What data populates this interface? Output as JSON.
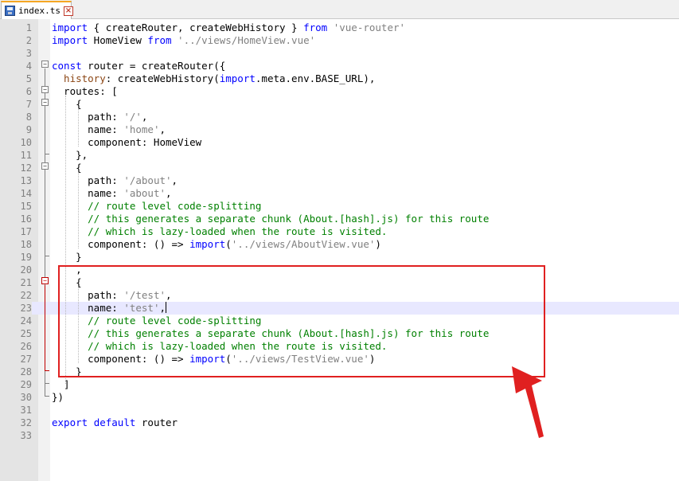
{
  "tab": {
    "filename": "index.ts"
  },
  "lines": [
    {
      "n": "1",
      "tokens": [
        [
          "kw",
          "import"
        ],
        [
          "fn",
          " { createRouter, createWebHistory } "
        ],
        [
          "kw",
          "from"
        ],
        [
          "str",
          " 'vue-router'"
        ]
      ]
    },
    {
      "n": "2",
      "tokens": [
        [
          "kw",
          "import"
        ],
        [
          "fn",
          " HomeView "
        ],
        [
          "kw",
          "from"
        ],
        [
          "str",
          " '../views/HomeView.vue'"
        ]
      ]
    },
    {
      "n": "3",
      "tokens": []
    },
    {
      "n": "4",
      "tokens": [
        [
          "kw",
          "const"
        ],
        [
          "fn",
          " router = createRouter({"
        ]
      ]
    },
    {
      "n": "5",
      "tokens": [
        [
          "orange",
          "  history"
        ],
        [
          "fn",
          ": createWebHistory("
        ],
        [
          "kw",
          "import"
        ],
        [
          "fn",
          ".meta.env.BASE_URL),"
        ]
      ]
    },
    {
      "n": "6",
      "tokens": [
        [
          "fn",
          "  routes: ["
        ]
      ]
    },
    {
      "n": "7",
      "tokens": [
        [
          "fn",
          "    {"
        ]
      ]
    },
    {
      "n": "8",
      "tokens": [
        [
          "fn",
          "      path: "
        ],
        [
          "str",
          "'/'"
        ],
        [
          "fn",
          ","
        ]
      ]
    },
    {
      "n": "9",
      "tokens": [
        [
          "fn",
          "      name: "
        ],
        [
          "str",
          "'home'"
        ],
        [
          "fn",
          ","
        ]
      ]
    },
    {
      "n": "10",
      "tokens": [
        [
          "fn",
          "      component: HomeView"
        ]
      ]
    },
    {
      "n": "11",
      "tokens": [
        [
          "fn",
          "    },"
        ]
      ]
    },
    {
      "n": "12",
      "tokens": [
        [
          "fn",
          "    {"
        ]
      ]
    },
    {
      "n": "13",
      "tokens": [
        [
          "fn",
          "      path: "
        ],
        [
          "str",
          "'/about'"
        ],
        [
          "fn",
          ","
        ]
      ]
    },
    {
      "n": "14",
      "tokens": [
        [
          "fn",
          "      name: "
        ],
        [
          "str",
          "'about'"
        ],
        [
          "fn",
          ","
        ]
      ]
    },
    {
      "n": "15",
      "tokens": [
        [
          "cmt",
          "      // route level code-splitting"
        ]
      ]
    },
    {
      "n": "16",
      "tokens": [
        [
          "cmt",
          "      // this generates a separate chunk (About.[hash].js) for this route"
        ]
      ]
    },
    {
      "n": "17",
      "tokens": [
        [
          "cmt",
          "      // which is lazy-loaded when the route is visited."
        ]
      ]
    },
    {
      "n": "18",
      "tokens": [
        [
          "fn",
          "      component: () => "
        ],
        [
          "kw",
          "import"
        ],
        [
          "fn",
          "("
        ],
        [
          "str",
          "'../views/AboutView.vue'"
        ],
        [
          "fn",
          ")"
        ]
      ]
    },
    {
      "n": "19",
      "tokens": [
        [
          "fn",
          "    }"
        ]
      ]
    },
    {
      "n": "20",
      "tokens": [
        [
          "fn",
          "    ,"
        ]
      ]
    },
    {
      "n": "21",
      "tokens": [
        [
          "fn",
          "    {"
        ]
      ]
    },
    {
      "n": "22",
      "tokens": [
        [
          "fn",
          "      path: "
        ],
        [
          "str",
          "'/test'"
        ],
        [
          "fn",
          ","
        ]
      ]
    },
    {
      "n": "23",
      "tokens": [
        [
          "fn",
          "      name: "
        ],
        [
          "str",
          "'test'"
        ],
        [
          "fn",
          ","
        ]
      ]
    },
    {
      "n": "24",
      "tokens": [
        [
          "cmt",
          "      // route level code-splitting"
        ]
      ]
    },
    {
      "n": "25",
      "tokens": [
        [
          "cmt",
          "      // this generates a separate chunk (About.[hash].js) for this route"
        ]
      ]
    },
    {
      "n": "26",
      "tokens": [
        [
          "cmt",
          "      // which is lazy-loaded when the route is visited."
        ]
      ]
    },
    {
      "n": "27",
      "tokens": [
        [
          "fn",
          "      component: () => "
        ],
        [
          "kw",
          "import"
        ],
        [
          "fn",
          "("
        ],
        [
          "str",
          "'../views/TestView.vue'"
        ],
        [
          "fn",
          ")"
        ]
      ]
    },
    {
      "n": "28",
      "tokens": [
        [
          "fn",
          "    }"
        ]
      ]
    },
    {
      "n": "29",
      "tokens": [
        [
          "fn",
          "  ]"
        ]
      ]
    },
    {
      "n": "30",
      "tokens": [
        [
          "fn",
          "})"
        ]
      ]
    },
    {
      "n": "31",
      "tokens": []
    },
    {
      "n": "32",
      "tokens": [
        [
          "kw",
          "export"
        ],
        [
          "fn",
          " "
        ],
        [
          "kw",
          "default"
        ],
        [
          "fn",
          " router"
        ]
      ]
    },
    {
      "n": "33",
      "tokens": []
    }
  ],
  "current_line": "23",
  "colors": {
    "keyword": "#0000ff",
    "string": "#808080",
    "comment": "#008000",
    "annotation": "#e02020"
  }
}
